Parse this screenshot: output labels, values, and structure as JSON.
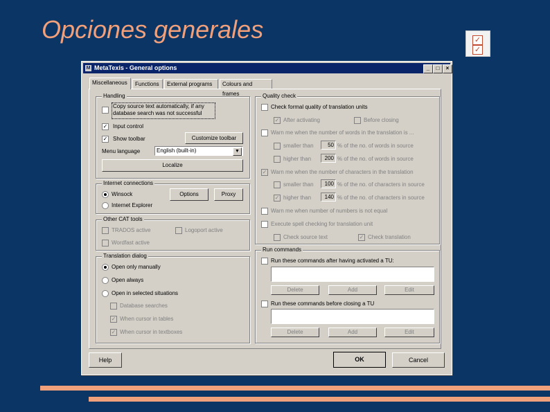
{
  "slide": {
    "title": "Opciones generales"
  },
  "window": {
    "title": "MetaTexis - General options",
    "controls": {
      "minimize": "_",
      "maximize": "□",
      "close": "×"
    },
    "tabs": [
      "Miscellaneous",
      "Functions",
      "External programs",
      "Colours and frames"
    ],
    "handling": {
      "title": "Handling",
      "copy_source_1": "Copy source text automatically, if any",
      "copy_source_2": "database search was not successful",
      "input_control": "Input control",
      "show_toolbar": "Show toolbar",
      "customize_toolbar": "Customize toolbar",
      "menu_language_label": "Menu language",
      "menu_language_value": "English (built-in)",
      "localize": "Localize"
    },
    "internet": {
      "title": "Internet connections",
      "winsock": "Winsock",
      "internet_explorer": "Internet Explorer",
      "options": "Options",
      "proxy": "Proxy"
    },
    "other_cat": {
      "title": "Other CAT tools",
      "trados": "TRADOS active",
      "logoport": "Logoport active",
      "wordfast": "Wordfast active"
    },
    "translation_dialog": {
      "title": "Translation dialog",
      "open_manually": "Open only manually",
      "open_always": "Open always",
      "open_selected": "Open in selected situations",
      "database_searches": "Database searches",
      "cursor_tables": "When cursor in tables",
      "cursor_textboxes": "When cursor in textboxes"
    },
    "quality": {
      "title": "Quality check",
      "check_formal": "Check formal quality of translation units",
      "after_activating": "After activating",
      "before_closing": "Before closing",
      "warn_words": "Warn me when the number of words in the translation is ...",
      "smaller_than": "smaller than",
      "higher_than": "higher than",
      "words_val_small": "50",
      "words_val_high": "200",
      "pct_words": "% of the no. of words in source",
      "warn_chars": "Warn me when the number of characters in the translation",
      "chars_val_small": "100",
      "chars_val_high": "140",
      "pct_chars": "% of the no. of characters in source",
      "warn_numbers": "Warn me when number of numbers is not equal",
      "spell_check": "Execute spell checking for translation unit",
      "check_source": "Check source text",
      "check_translation": "Check translation"
    },
    "run_commands": {
      "title": "Run commands",
      "after_activated": "Run these commands after having activated a TU:",
      "before_closing": "Run these commands before closing a TU",
      "delete": "Delete",
      "add": "Add",
      "edit": "Edit"
    },
    "footer": {
      "help": "Help",
      "ok": "OK",
      "cancel": "Cancel"
    },
    "check_glyph": "✓"
  }
}
